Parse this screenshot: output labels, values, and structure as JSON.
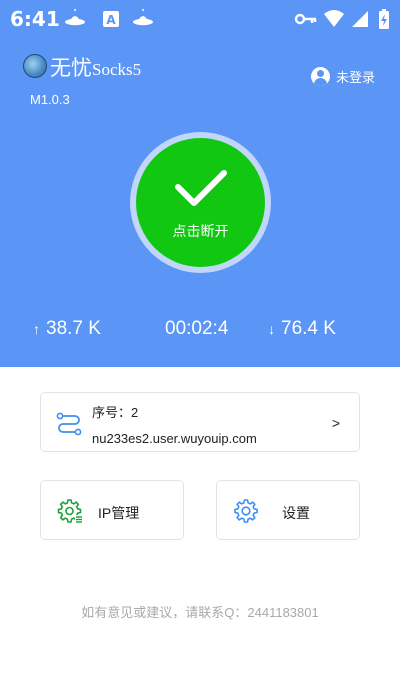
{
  "status_bar": {
    "time": "6:41",
    "left_icons": [
      "ufo-icon",
      "text-a-icon",
      "ufo-icon"
    ],
    "right_icons": [
      "vpn-key-icon",
      "wifi-icon",
      "signal-icon",
      "battery-charging-icon"
    ]
  },
  "header": {
    "app_name_cn": "无忧",
    "app_name_latin": "Socks5",
    "version": "M1.0.3",
    "login_label": "未登录"
  },
  "connect": {
    "label": "点击断开",
    "state": "connected",
    "color": "#11c711"
  },
  "stats": {
    "upload_arrow": "↑",
    "upload": "38.7 K",
    "duration": "00:02:4",
    "download_arrow": "↓",
    "download": "76.4 K"
  },
  "server": {
    "index_label": "序号：2",
    "host": "nu233es2.user.wuyouip.com",
    "chevron": ">"
  },
  "tiles": {
    "ip_manage_label": "IP管理",
    "settings_label": "设置"
  },
  "footer": {
    "contact": "如有意见或建议，请联系Q：2441183801"
  },
  "colors": {
    "primary": "#5b95f5",
    "connected": "#11c711",
    "muted_text": "#a9a9a9"
  }
}
